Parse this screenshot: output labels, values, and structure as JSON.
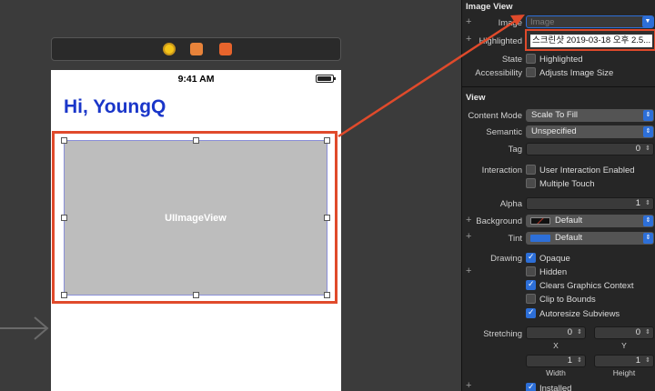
{
  "device": {
    "time": "9:41 AM",
    "nav_title": "Hi, YoungQ",
    "image_view_label": "UIImageView"
  },
  "inspector": {
    "image_view_section": "Image View",
    "image_label": "Image",
    "image_placeholder": "Image",
    "image_dropdown_item": "스크린샷 2019-03-18 오후 2.5...",
    "highlighted_label": "Highlighted",
    "state_label": "State",
    "state_option": "Highlighted",
    "accessibility_label": "Accessibility",
    "accessibility_option": "Adjusts Image Size",
    "view_section": "View",
    "content_mode_label": "Content Mode",
    "content_mode_value": "Scale To Fill",
    "semantic_label": "Semantic",
    "semantic_value": "Unspecified",
    "tag_label": "Tag",
    "tag_value": "0",
    "interaction_label": "Interaction",
    "interaction_opt1": "User Interaction Enabled",
    "interaction_opt2": "Multiple Touch",
    "alpha_label": "Alpha",
    "alpha_value": "1",
    "background_label": "Background",
    "background_value": "Default",
    "tint_label": "Tint",
    "tint_value": "Default",
    "drawing_label": "Drawing",
    "drawing_opts": [
      "Opaque",
      "Hidden",
      "Clears Graphics Context",
      "Clip to Bounds",
      "Autoresize Subviews"
    ],
    "stretching_label": "Stretching",
    "stretch_x_value": "0",
    "stretch_y_value": "0",
    "stretch_x_label": "X",
    "stretch_y_label": "Y",
    "stretch_w_value": "1",
    "stretch_h_value": "1",
    "stretch_w_label": "Width",
    "stretch_h_label": "Height",
    "installed_label": "Installed",
    "plus_sign": "+"
  },
  "colors": {
    "title_blue": "#1a36c9",
    "highlight_red": "#e04a2b",
    "accent_blue": "#2d6fd8",
    "image_view_gray": "#bdbdbd"
  },
  "icons": [
    "view-controller-icon",
    "first-responder-icon",
    "exit-icon",
    "entry-point-arrow-icon",
    "battery-icon"
  ]
}
